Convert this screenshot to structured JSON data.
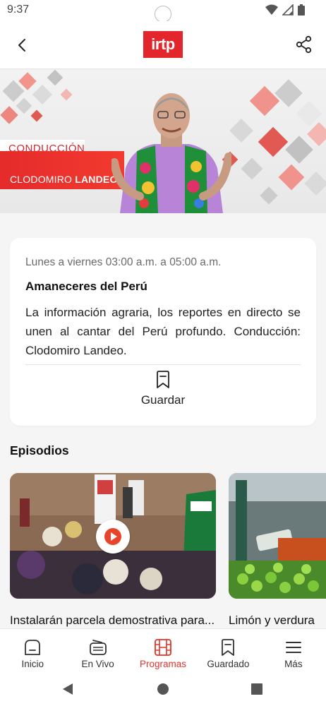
{
  "status_bar": {
    "time": "9:37"
  },
  "header": {
    "logo_text": "irtp"
  },
  "hero": {
    "tag": "CONDUCCIÓN",
    "host_first": "CLODOMIRO ",
    "host_last": "LANDEO"
  },
  "program": {
    "schedule": "Lunes a viernes 03:00 a.m. a 05:00 a.m.",
    "title": "Amaneceres del Perú",
    "description": "La información agraria, los reportes en directo se unen al cantar del Perú profundo. Conducción: Clodomiro Landeo.",
    "save_label": "Guardar"
  },
  "episodes": {
    "section_title": "Episodios",
    "items": [
      {
        "title": "Instalarán parcela demostrativa para..."
      },
      {
        "title": "Limón y verdura"
      }
    ]
  },
  "bottom_nav": [
    {
      "label": "Inicio",
      "icon": "home-icon"
    },
    {
      "label": "En Vivo",
      "icon": "radio-icon"
    },
    {
      "label": "Programas",
      "icon": "film-icon",
      "active": true
    },
    {
      "label": "Guardado",
      "icon": "bookmark-icon"
    },
    {
      "label": "Más",
      "icon": "menu-icon"
    }
  ],
  "colors": {
    "accent": "#e2332a",
    "brand_red": "#e3262b"
  }
}
